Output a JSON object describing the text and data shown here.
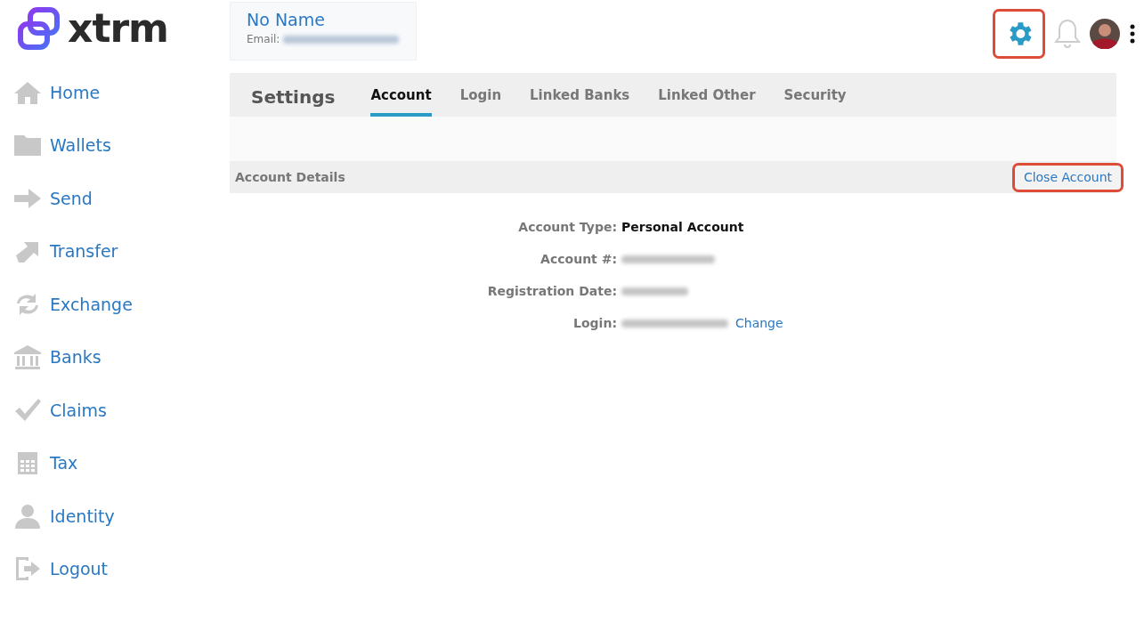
{
  "logo": {
    "text": "xtrm"
  },
  "profile": {
    "name": "No Name",
    "email_label": "Email:",
    "email_redacted": true
  },
  "topbar": {
    "settings_highlighted": true
  },
  "sidebar": {
    "items": [
      {
        "label": "Home",
        "kind": "home"
      },
      {
        "label": "Wallets",
        "kind": "folder"
      },
      {
        "label": "Send",
        "kind": "arrow"
      },
      {
        "label": "Transfer",
        "kind": "diag"
      },
      {
        "label": "Exchange",
        "kind": "cycle"
      },
      {
        "label": "Banks",
        "kind": "bank"
      },
      {
        "label": "Claims",
        "kind": "check"
      },
      {
        "label": "Tax",
        "kind": "calc"
      },
      {
        "label": "Identity",
        "kind": "person"
      },
      {
        "label": "Logout",
        "kind": "logout"
      }
    ]
  },
  "settings": {
    "title": "Settings",
    "tabs": [
      {
        "label": "Account",
        "selected": true
      },
      {
        "label": "Login",
        "selected": false
      },
      {
        "label": "Linked Banks",
        "selected": false
      },
      {
        "label": "Linked Other",
        "selected": false
      },
      {
        "label": "Security",
        "selected": false
      }
    ]
  },
  "account_details": {
    "title": "Account Details",
    "close_button": {
      "label": "Close Account",
      "highlighted": true
    },
    "rows": [
      {
        "label": "Account Type:",
        "value": "Personal Account",
        "redacted": false
      },
      {
        "label": "Account #:",
        "redacted": true
      },
      {
        "label": "Registration Date:",
        "redacted": true
      },
      {
        "label": "Login:",
        "redacted": true,
        "link": "Change"
      }
    ]
  }
}
